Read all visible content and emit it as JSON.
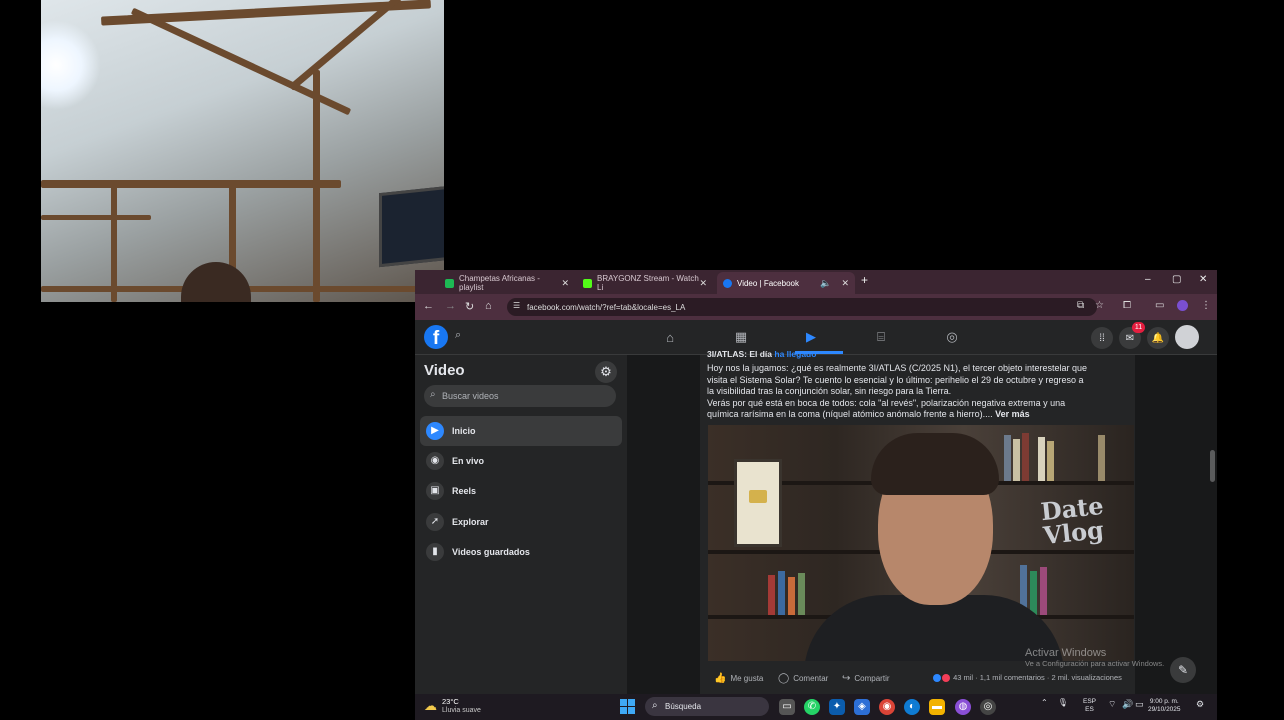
{
  "browser": {
    "tabs": [
      {
        "title": "Champetas Africanas - playlist",
        "color": "#1db954"
      },
      {
        "title": "BRAYGONZ Stream - Watch Li",
        "color": "#53fc18"
      },
      {
        "title": "Video | Facebook",
        "color": "#1877f2"
      }
    ],
    "new_tab": "+",
    "window_controls": {
      "minimize": "–",
      "maximize": "▢",
      "close": "✕"
    },
    "url": "facebook.com/watch/?ref=tab&locale=es_LA"
  },
  "facebook": {
    "logo": "f",
    "nav_icons": [
      "home-icon",
      "feeds-icon",
      "video-icon",
      "marketplace-icon",
      "gaming-icon"
    ],
    "messenger_badge": "11",
    "sidebar": {
      "title": "Video",
      "search_placeholder": "Buscar videos",
      "items": [
        {
          "label": "Inicio",
          "icon": "play-icon",
          "active": true
        },
        {
          "label": "En vivo",
          "icon": "live-camera-icon",
          "active": false
        },
        {
          "label": "Reels",
          "icon": "reels-icon",
          "active": false
        },
        {
          "label": "Explorar",
          "icon": "rocket-icon",
          "active": false
        },
        {
          "label": "Videos guardados",
          "icon": "bookmark-icon",
          "active": false
        }
      ]
    },
    "post": {
      "header_prefix": "3I/ATLAS: El día ",
      "header_link": "ha llegado",
      "line1": "Hoy nos la jugamos: ¿qué es realmente 3I/ATLAS (C/2025 N1), el tercer objeto interestelar que",
      "line2": "visita el Sistema Solar? Te cuento lo esencial y lo último: perihelio el 29 de octubre y regreso a",
      "line3": "la visibilidad tras la conjunción solar, sin riesgo para la Tierra.",
      "line4": "Verás por qué está en boca de todos: cola \"al revés\", polarización negativa extrema y una",
      "line5": "química rarísima en la coma (níquel atómico anómalo frente a hierro)....",
      "see_more": "Ver más",
      "video_sign": "Date\nun Vlog",
      "actions": {
        "like": "Me gusta",
        "comment": "Comentar",
        "share": "Compartir"
      },
      "stats": "43 mil · 1,1 mil comentarios · 2 mil. visualizaciones"
    }
  },
  "watermark": {
    "line1": "Activar Windows",
    "line2": "Ve a Configuración para activar Windows."
  },
  "taskbar": {
    "weather_temp": "23°C",
    "weather_desc": "Lluvia suave",
    "search_placeholder": "Búsqueda",
    "lang_top": "ESP",
    "lang_bottom": "ES",
    "time": "9:00 p. m.",
    "date": "29/10/2025"
  }
}
